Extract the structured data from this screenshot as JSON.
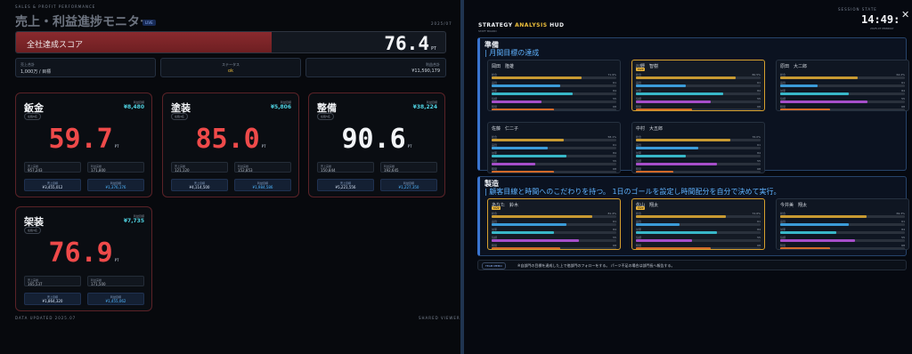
{
  "left": {
    "subtitle": "SALES & PROFIT PERFORMANCE",
    "title": "売上・利益進捗モニター",
    "badge": "LIVE",
    "top_right": "2025/07",
    "overall": {
      "label": "全社達成スコア",
      "value": "76.4",
      "unit": "PT",
      "fill_fraction": 0.764
    },
    "stats": [
      {
        "label": "売上合計",
        "value": "1,000万 / 目標"
      },
      {
        "label": "ステータス",
        "value": "ok"
      },
      {
        "label": "利益合計",
        "value": "¥11,590,179"
      }
    ],
    "cards": [
      {
        "name": "鈑金",
        "tag": "在籍6名",
        "target_label": "利益目標",
        "target": "¥8,480",
        "score": "59.7",
        "unit": "PT",
        "color": "#ef4a4a",
        "m1_label": "売上実績",
        "m1_value": "957,243",
        "m2_label": "利益実績",
        "m2_value": "171,800",
        "w1_label": "売上目標",
        "w1_value": "¥3,455,012",
        "w2_label": "利益目標",
        "w2_value": "¥1,376,176"
      },
      {
        "name": "塗装",
        "tag": "在籍4名",
        "target_label": "利益目標",
        "target": "¥5,806",
        "score": "85.0",
        "unit": "PT",
        "color": "#ef4a4a",
        "m1_label": "売上実績",
        "m1_value": "121,120",
        "m2_label": "利益実績",
        "m2_value": "152,853",
        "w1_label": "売上目標",
        "w1_value": "¥4,114,500",
        "w2_label": "利益目標",
        "w2_value": "¥1,984,586"
      },
      {
        "name": "整備",
        "tag": "在籍5名",
        "target_label": "利益目標",
        "target": "¥38,224",
        "score": "90.6",
        "unit": "PT",
        "color": "#f3f5f8",
        "m1_label": "売上実績",
        "m1_value": "150,844",
        "m2_label": "利益実績",
        "m2_value": "192,645",
        "w1_label": "売上目標",
        "w1_value": "¥5,221,556",
        "w2_label": "利益目標",
        "w2_value": "¥1,227,350"
      },
      {
        "name": "架装",
        "tag": "在籍3名",
        "target_label": "利益目標",
        "target": "¥7,735",
        "score": "76.9",
        "unit": "PT",
        "color": "#ef4a4a",
        "m1_label": "売上実績",
        "m1_value": "165,537",
        "m2_label": "利益実績",
        "m2_value": "171,500",
        "w1_label": "売上目標",
        "w1_value": "¥1,864,320",
        "w2_label": "利益目標",
        "w2_value": "¥1,455,062"
      }
    ],
    "footer_left": "DATA UPDATED 2025.07",
    "footer_right": "SHARED VIEWER"
  },
  "right": {
    "logo_a": "STRATEGY ",
    "logo_b": "ANALYSIS",
    "logo_c": " HUD",
    "logo_sub": "STAFF BOARD",
    "top_sub": "SESSION STATE",
    "clock": "14:49:",
    "date": "2025.07 MONDAY",
    "close": "✕",
    "sections": [
      {
        "title": "準備",
        "goal": "| 月間目標の達成",
        "people": [
          {
            "name": "岡田　隆雄",
            "badge": "",
            "pct": "71.9%"
          },
          {
            "name": "川野　智樹",
            "badge": "MVP",
            "pct": "80.5%"
          },
          {
            "name": "原田　大二郎",
            "badge": "",
            "pct": "64.2%"
          },
          {
            "name": "佐藤　仁二子",
            "badge": "",
            "pct": "58.1%"
          },
          {
            "name": "中村　大五郎",
            "badge": "",
            "pct": "76.0%"
          }
        ]
      },
      {
        "title": "製造",
        "goal": "| 顧客目線と時間へのこだわりを持つ。 1日のゴールを設定し時間配分を自分で決めて実行。",
        "people": [
          {
            "name": "あなた　鈴木",
            "badge": "MVP",
            "pct": "81.4%"
          },
          {
            "name": "佐山　翔太",
            "badge": "MVP",
            "pct": "72.6%"
          },
          {
            "name": "今井美　翔太",
            "badge": "",
            "pct": "69.3%"
          }
        ]
      }
    ],
    "row_labels": [
      "総合",
      "品質",
      "効率",
      "協調",
      "時間"
    ],
    "row_values": [
      "72",
      "61",
      "84",
      "55",
      "68"
    ],
    "colors": {
      "gold": "#c89a32",
      "blue": "#3b9bd8",
      "cyan": "#38b7c8",
      "purple": "#a64ec9",
      "orange": "#d26a2a"
    },
    "footer_badge": "TEAM MEMO",
    "footer_text": "※自部門の目標を達成した上で他部門のフォローをする。 パーツ不足の場合は部門長へ報告する。"
  }
}
